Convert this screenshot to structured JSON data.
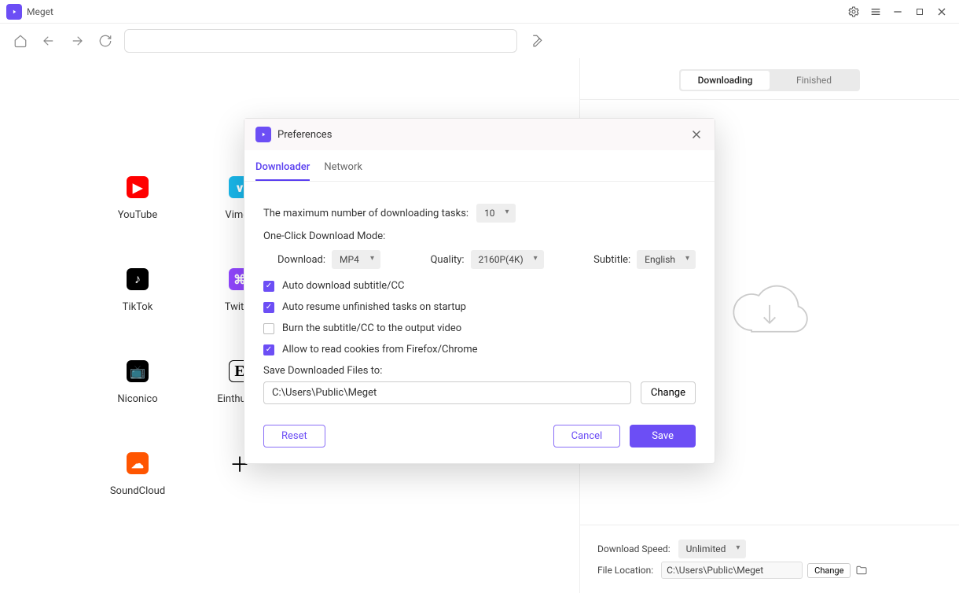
{
  "app": {
    "title": "Meget"
  },
  "sites": [
    {
      "id": "youtube",
      "label": "YouTube",
      "cls": "yt",
      "glyph": "▶"
    },
    {
      "id": "vimeo",
      "label": "Vimeo",
      "cls": "vm",
      "glyph": "v"
    },
    {
      "id": "tiktok",
      "label": "TikTok",
      "cls": "tk",
      "glyph": "♪"
    },
    {
      "id": "twitch",
      "label": "Twitch",
      "cls": "tw",
      "glyph": "⌘"
    },
    {
      "id": "niconico",
      "label": "Niconico",
      "cls": "nc",
      "glyph": "📺"
    },
    {
      "id": "einthusan",
      "label": "Einthusan",
      "cls": "ei",
      "glyph": "E"
    },
    {
      "id": "soundcloud",
      "label": "SoundCloud",
      "cls": "sc",
      "glyph": "☁"
    },
    {
      "id": "add",
      "label": "",
      "cls": "pl",
      "glyph": "＋"
    }
  ],
  "right": {
    "tabs": {
      "downloading": "Downloading",
      "finished": "Finished",
      "active": "downloading"
    },
    "footer": {
      "speed_label": "Download Speed:",
      "speed_value": "Unlimited",
      "loc_label": "File Location:",
      "loc_value": "C:\\Users\\Public\\Meget",
      "change": "Change"
    }
  },
  "prefs": {
    "title": "Preferences",
    "tabs": {
      "downloader": "Downloader",
      "network": "Network",
      "active": "downloader"
    },
    "max_tasks_label": "The maximum number of downloading tasks:",
    "max_tasks_value": "10",
    "one_click_label": "One-Click Download Mode:",
    "download_label": "Download:",
    "download_value": "MP4",
    "quality_label": "Quality:",
    "quality_value": "2160P(4K)",
    "subtitle_label": "Subtitle:",
    "subtitle_value": "English",
    "checks": [
      {
        "id": "auto_sub",
        "label": "Auto download subtitle/CC",
        "checked": true
      },
      {
        "id": "auto_resume",
        "label": "Auto resume unfinished tasks on startup",
        "checked": true
      },
      {
        "id": "burn_sub",
        "label": "Burn the subtitle/CC to the output video",
        "checked": false
      },
      {
        "id": "read_cookies",
        "label": "Allow to read cookies from Firefox/Chrome",
        "checked": true
      }
    ],
    "save_to_label": "Save Downloaded Files to:",
    "save_to_value": "C:\\Users\\Public\\Meget",
    "change": "Change",
    "reset": "Reset",
    "cancel": "Cancel",
    "save": "Save"
  }
}
